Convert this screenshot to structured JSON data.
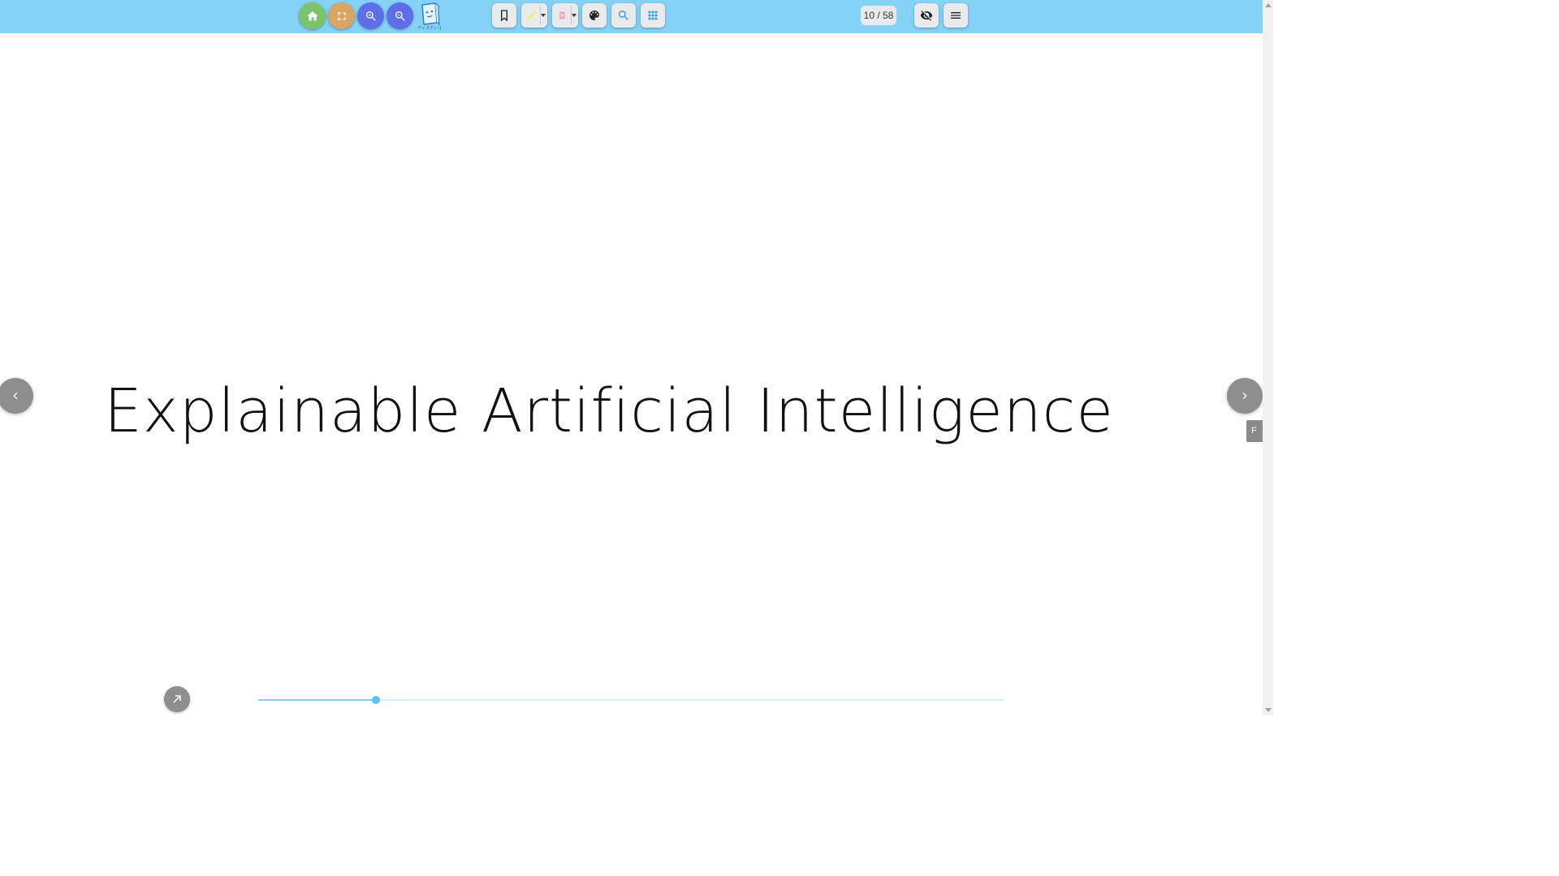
{
  "toolbar": {
    "background_color": "#84d3f7",
    "buttons": [
      {
        "name": "home",
        "icon": "home-icon",
        "color": "#7cc46a"
      },
      {
        "name": "fullscreen",
        "icon": "fullscreen-icon",
        "color": "#d8a565"
      },
      {
        "name": "zoom-in",
        "icon": "zoom-in-icon",
        "color": "#5e6ee8"
      },
      {
        "name": "zoom-out",
        "icon": "zoom-out-icon",
        "color": "#5e6ee8"
      }
    ],
    "logo_caption": "ディスディコ",
    "tools": [
      {
        "name": "bookmark",
        "icon": "bookmark-icon"
      },
      {
        "name": "highlighter",
        "icon": "highlighter-icon",
        "color": "#f3e84a"
      },
      {
        "name": "eraser",
        "icon": "eraser-icon",
        "color": "#f2a6b6"
      },
      {
        "name": "palette",
        "icon": "palette-icon"
      },
      {
        "name": "search",
        "icon": "search-icon",
        "color": "#2196f3"
      },
      {
        "name": "grid",
        "icon": "grid-icon",
        "color": "#2196f3"
      }
    ],
    "page_counter": "10 / 58",
    "right_buttons": [
      {
        "name": "hide-toolbar",
        "icon": "eye-off-icon"
      },
      {
        "name": "menu",
        "icon": "menu-icon"
      }
    ]
  },
  "slide": {
    "title": "Explainable Artificial Intelligence"
  },
  "navigation": {
    "prev_icon": "chevron-left-icon",
    "next_icon": "chevron-right-icon",
    "side_tab_label": "F"
  },
  "progress": {
    "current_page": 10,
    "total_pages": 58,
    "fraction": 0.158
  },
  "expand_icon": "arrow-up-right-icon"
}
